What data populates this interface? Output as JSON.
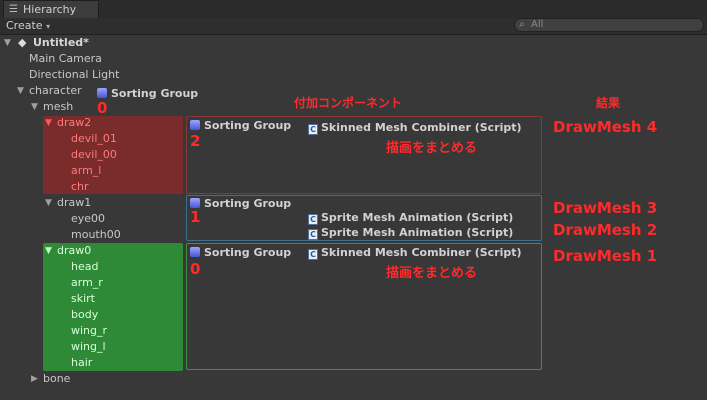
{
  "window": {
    "tab_title": "Hierarchy",
    "create_label": "Create",
    "search_placeholder": "All"
  },
  "tree": {
    "scene": "Untitled*",
    "main_camera": "Main Camera",
    "directional_light": "Directional Light",
    "character": "character",
    "mesh": "mesh",
    "draw2": "draw2",
    "draw2_children": [
      "devil_01",
      "devil_00",
      "arm_l",
      "chr"
    ],
    "draw1": "draw1",
    "draw1_children": [
      "eye00",
      "mouth00"
    ],
    "draw0": "draw0",
    "draw0_children": [
      "head",
      "arm_r",
      "skirt",
      "body",
      "wing_r",
      "wing_l",
      "hair"
    ],
    "bone": "bone"
  },
  "annotations": {
    "mesh_sorting_label": "Sorting Group",
    "mesh_sorting_order": "0",
    "components_header": "付加コンポーネント",
    "result_header": "結果",
    "sorting_group": "Sorting Group",
    "draw2_order": "2",
    "draw1_order": "1",
    "draw0_order": "0",
    "skinned_mesh_combiner": "Skinned Mesh Combiner (Script)",
    "sprite_mesh_animation": "Sprite Mesh Animation (Script)",
    "combine_note": "描画をまとめる",
    "results": [
      "DrawMesh 4",
      "DrawMesh 3",
      "DrawMesh 2",
      "DrawMesh 1"
    ]
  },
  "colors": {
    "draw2_bg": "#7a2c2c",
    "draw0_bg": "#2f8a38",
    "red_box": "#8c3535",
    "blue_box": "#3c7090",
    "green_box": "#3f8f46",
    "annotation_red": "#ff2a2a"
  }
}
